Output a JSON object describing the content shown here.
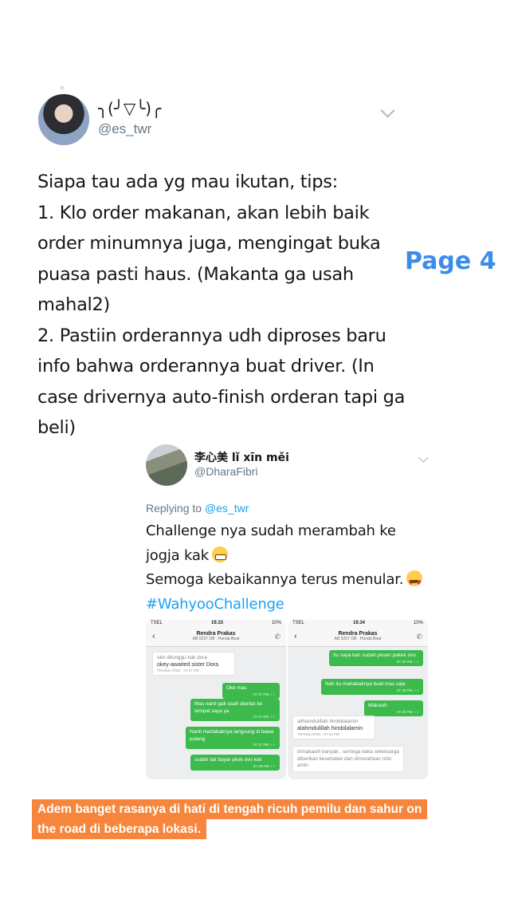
{
  "tweet": {
    "display_name": "╮(╯▽╰)╭",
    "handle": "@es_twr",
    "text": "Siapa tau ada yg mau ikutan, tips:\n1. Klo order makanan, akan lebih baik order minumnya juga, mengingat buka puasa pasti haus. (Makanta ga usah mahal2)\n2. Pastiin orderannya udh diproses baru info bahwa orderannya buat driver. (In case drivernya auto-finish orderan tapi ga beli)"
  },
  "page_label": "Page 4",
  "reply": {
    "display_name": "李心美 lǐ xīn měi",
    "handle": "@DharaFibri",
    "replying_prefix": "Replying to ",
    "replying_to": "@es_twr",
    "line1": "Challenge nya sudah merambah ke",
    "line2": "jogja kak",
    "line3": "Semoga kebaikannya terus menular.",
    "hashtag": "#WahyooChallenge"
  },
  "screenshots": {
    "left": {
      "carrier": "TSEL",
      "time": "19.33",
      "battery": "10%",
      "contact": "Rendra Prakas",
      "plate": "AB 5237 OB · Honda Beat",
      "msg1_original": "oke ditunggu kak dora",
      "msg1_translation": "okey-awaited sister Dora",
      "msg1_meta": "TRANSLATED · 07.27 PM",
      "msg2": "Oke mas",
      "msg2_meta": "07.27 PM ✓✓",
      "msg3": "Mas nanti gak usah diantar ke tempat saya ya",
      "msg3_meta": "07.27 PM ✓✓",
      "msg4": "Nanti martabaknya langsung di bawa pulang",
      "msg4_meta": "07.27 PM ✓✓",
      "msg5": "sudah tak bayar pkek ovo kok",
      "msg5_meta": "07.28 PM ✓✓"
    },
    "right": {
      "carrier": "TSEL",
      "time": "19.34",
      "battery": "10%",
      "contact": "Rendra Prakas",
      "plate": "AB 5237 OB · Honda Beat",
      "msg1": "Itu saya kan sudah pesen pakek ovo",
      "msg1_meta": "07.30 PM ✓✓",
      "msg2": "Nah itu martabaknya buat mas saja",
      "msg2_meta": "07.30 PM ✓✓",
      "msg3": "Makasih",
      "msg3_meta": "07.30 PM ✓✓",
      "msg4_original": "allhamdulillah hirobilalamin",
      "msg4_translation": "alahmdulillah hirobilalamin",
      "msg4_meta": "TRANSLATED · 07.31 PM",
      "msg5": "trimakasih banyak.. semoga kaka sekeluarga diberikan kesehatan dan dimurahkan rizki amin"
    }
  },
  "caption": {
    "line1": "Adem banget rasanya di hati di tengah ricuh pemilu dan sahur on",
    "line2": "the road di beberapa lokasi."
  },
  "colors": {
    "link": "#1da1f2",
    "page_label": "#3b8ee8",
    "caption_bg": "#f7853b",
    "chat_out": "#3cba4c"
  }
}
